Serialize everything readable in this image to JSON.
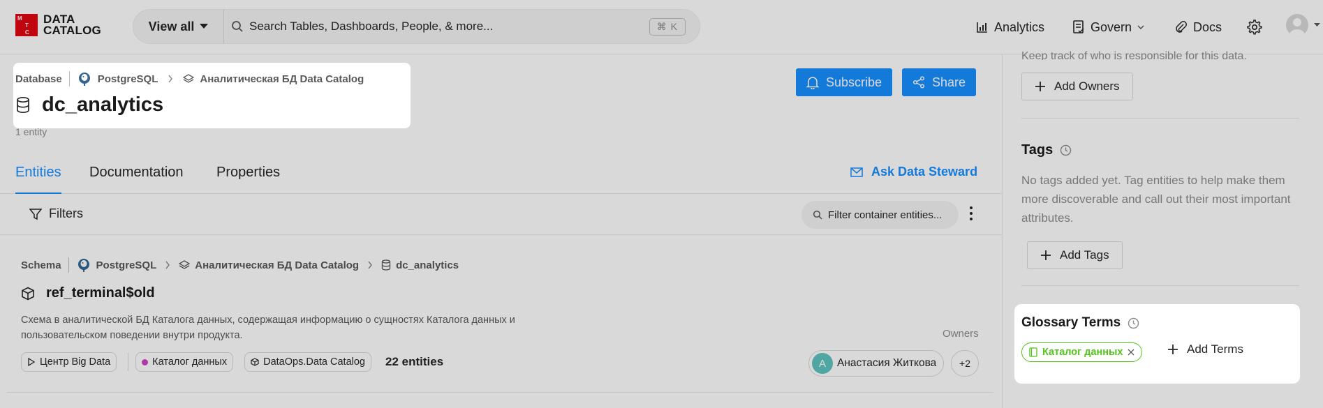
{
  "header": {
    "logo_mark": [
      "M",
      "T",
      "C"
    ],
    "logo_text_line1": "DATA",
    "logo_text_line2": "CATALOG",
    "view_all_label": "View all",
    "search_placeholder": "Search Tables, Dashboards, People, & more...",
    "shortcut": "⌘ K",
    "nav": {
      "analytics": "Analytics",
      "govern": "Govern",
      "docs": "Docs"
    }
  },
  "entity": {
    "breadcrumb": {
      "type": "Database",
      "platform": "PostgreSQL",
      "container": "Аналитическая БД Data Catalog"
    },
    "title": "dc_analytics",
    "count": "1 entity",
    "subscribe_label": "Subscribe",
    "share_label": "Share"
  },
  "tabs": [
    {
      "label": "Entities",
      "active": true
    },
    {
      "label": "Documentation",
      "active": false
    },
    {
      "label": "Properties",
      "active": false
    }
  ],
  "ask_steward_label": "Ask Data Steward",
  "filters": {
    "label": "Filters",
    "search_placeholder": "Filter container entities..."
  },
  "schema_card": {
    "breadcrumb": {
      "type": "Schema",
      "platform": "PostgreSQL",
      "container": "Аналитическая БД Data Catalog",
      "database": "dc_analytics"
    },
    "title": "ref_terminal$old",
    "description": "Схема в аналитической БД Каталога данных, содержащая информацию о сущностях Каталога данных и пользовательском поведении внутри продукта.",
    "owners_label": "Owners",
    "domain_chip": "Центр Big Data",
    "tag_chip": "Каталог данных",
    "product_chip": "DataOps.Data Catalog",
    "entities": "22 entities",
    "owner_name": "Анастасия Житкова",
    "owner_initial": "A",
    "owner_more": "+2"
  },
  "sidebar": {
    "owners_desc_cut": "Keep track of who is responsible for this data.",
    "add_owners_label": "Add Owners",
    "tags_heading": "Tags",
    "tags_desc": "No tags added yet. Tag entities to help make them more discoverable and call out their most important attributes.",
    "add_tags_label": "Add Tags",
    "glossary_heading": "Glossary Terms",
    "glossary_term": "Каталог данных",
    "add_terms_label": "Add Terms"
  },
  "colors": {
    "accent": "#1890ff",
    "brand_red": "#e30611",
    "glossary_green": "#52c41a",
    "tag_dot": "#d341c7",
    "overlay": "rgba(0,0,0,0.15)"
  }
}
